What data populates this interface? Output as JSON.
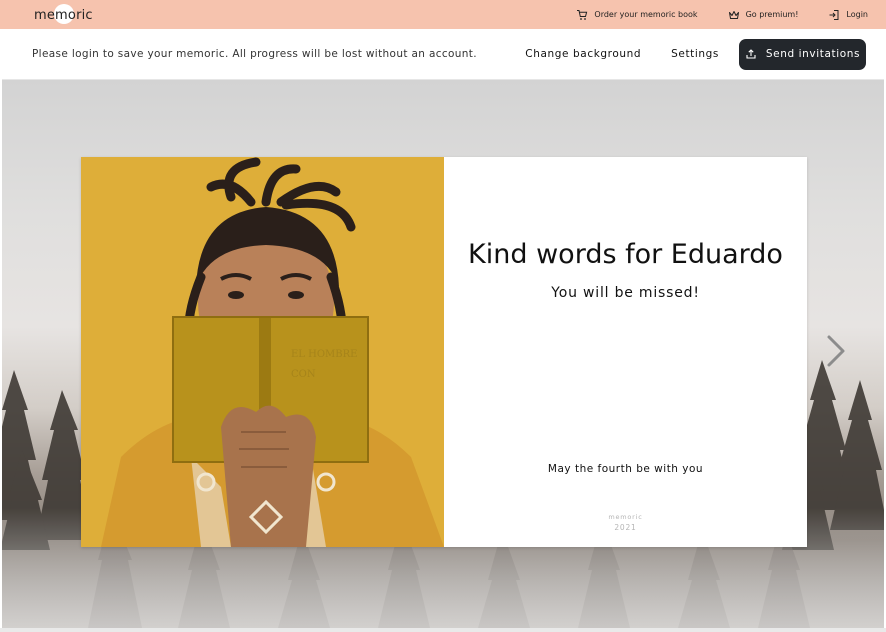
{
  "app": {
    "logo_text": "memoric"
  },
  "topnav": {
    "order_label": "Order your memoric book",
    "order_icon": "cart-icon",
    "premium_label": "Go premium!",
    "premium_icon": "crown-icon",
    "login_label": "Login",
    "login_icon": "login-icon"
  },
  "subbar": {
    "notice": "Please login to save your memoric. All progress will be lost without an account.",
    "change_background_label": "Change background",
    "settings_label": "Settings",
    "send_invitations_label": "Send invitations",
    "send_icon": "upload-icon"
  },
  "card": {
    "title": "Kind words for Eduardo",
    "subtitle": "You will be missed!",
    "closing": "May the fourth be with you",
    "brand": "memoric",
    "year": "2021",
    "photo_icon": "portrait-photo"
  },
  "navigation": {
    "next_icon": "chevron-right-icon"
  },
  "colors": {
    "topbar": "#f6c3ae",
    "button_dark": "#23272c",
    "photo_background": "#e0b23d"
  }
}
